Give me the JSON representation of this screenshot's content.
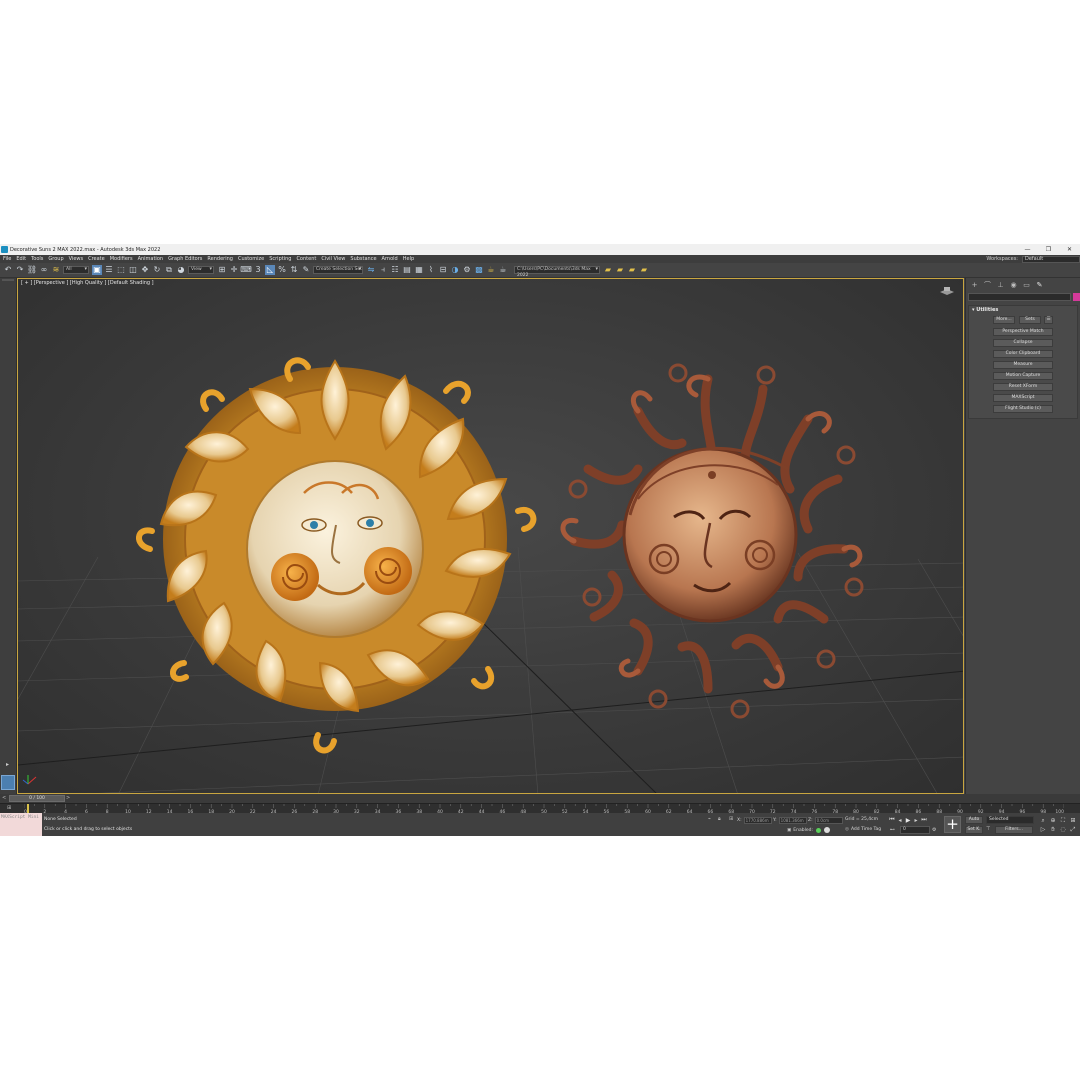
{
  "window": {
    "title": "Decorative Suns 2 MAX 2022.max - Autodesk 3ds Max 2022",
    "controls": [
      "—",
      "❐",
      "✕"
    ]
  },
  "menu": {
    "items": [
      "File",
      "Edit",
      "Tools",
      "Group",
      "Views",
      "Create",
      "Modifiers",
      "Animation",
      "Graph Editors",
      "Rendering",
      "Customize",
      "Scripting",
      "Content",
      "Civil View",
      "Substance",
      "Arnold",
      "Help"
    ],
    "workspaces_label": "Workspaces:",
    "workspace_value": "Default"
  },
  "toolbar": {
    "selection_filter": "All",
    "ref_coord": "View",
    "named_selection": "Create Selection Set",
    "project_path": "C:\\Users\\PC\\Documents\\3ds Max 2022"
  },
  "viewport": {
    "label": "[ + ] [Perspective ] [High Quality ] [Default Shading ]"
  },
  "command_panel": {
    "tab_icons": [
      "plus-icon",
      "bend-icon",
      "hierarchy-icon",
      "motion-icon",
      "display-icon",
      "utilities-icon"
    ],
    "rollout_title": "Utilities",
    "more_label": "More...",
    "sets_label": "Sets",
    "utilities": [
      "Perspective Match",
      "Collapse",
      "Color Clipboard",
      "Measure",
      "Motion Capture",
      "Reset XForm",
      "MAXScript",
      "Flight Studio (c)"
    ]
  },
  "time_slider": {
    "position": "0 / 100",
    "left_arrow": "<",
    "right_arrow": ">",
    "current_frame": 0,
    "total_frames": 100
  },
  "track_bar": {
    "ticks": [
      "0",
      "2",
      "4",
      "6",
      "8",
      "10",
      "12",
      "14",
      "16",
      "18",
      "20",
      "22",
      "24",
      "26",
      "28",
      "30",
      "32",
      "34",
      "36",
      "38",
      "40",
      "42",
      "44",
      "46",
      "48",
      "50",
      "52",
      "54",
      "56",
      "58",
      "60",
      "62",
      "64",
      "66",
      "68",
      "70",
      "72",
      "74",
      "76",
      "78",
      "80",
      "82",
      "84",
      "86",
      "88",
      "90",
      "92",
      "94",
      "96",
      "98",
      "100"
    ]
  },
  "status": {
    "maxscript_label": "MAXScript Mini",
    "selection": "None Selected",
    "prompt": "Click or click and drag to select objects",
    "x_label": "X:",
    "x_value": "1770.886m",
    "y_label": "Y:",
    "y_value": "1081.366m",
    "z_label": "Z:",
    "z_value": "0.0cm",
    "grid": "Grid = 25,4cm",
    "enabled_label": "Enabled:",
    "add_time_tag": "Add Time Tag",
    "auto_label": "Auto",
    "set_k_label": "Set K.",
    "selected_value": "Selected",
    "filters_label": "Filters...",
    "frame_value": "0"
  },
  "colors": {
    "viewport_border": "#c9a640",
    "accent_active": "#5a87b8",
    "sun_gold": "#e0a030",
    "sun_copper": "#8a4a32"
  }
}
